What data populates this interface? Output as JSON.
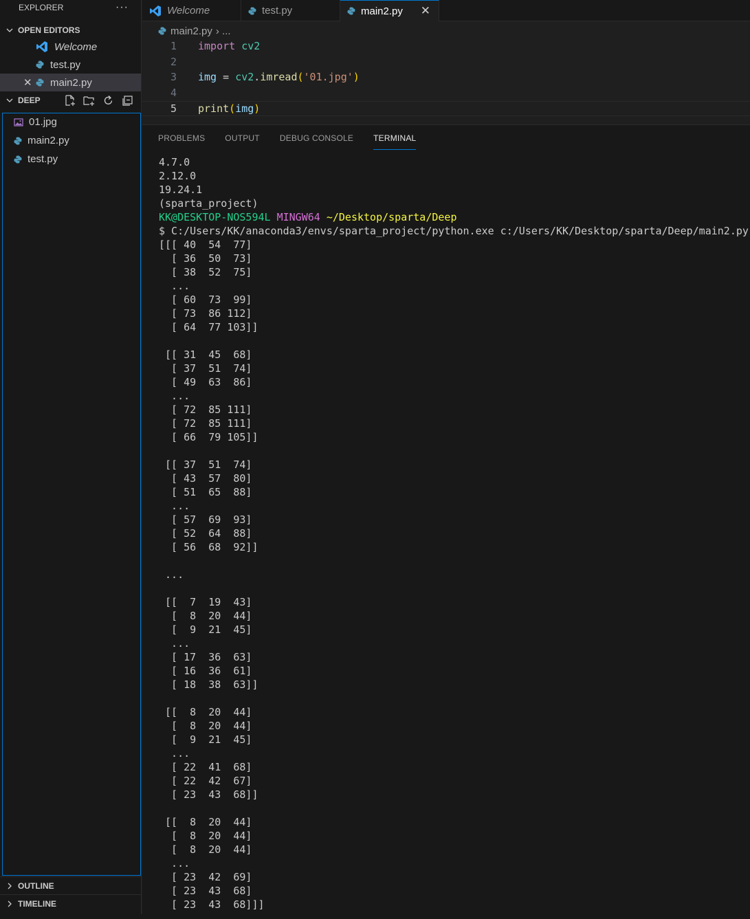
{
  "explorer": {
    "title": "EXPLORER",
    "more": "···",
    "open_editors_label": "OPEN EDITORS",
    "open_editors": [
      {
        "label": "Welcome",
        "icon": "vscode-icon"
      },
      {
        "label": "test.py",
        "icon": "python-icon"
      },
      {
        "label": "main2.py",
        "icon": "python-icon"
      }
    ],
    "folder_label": "DEEP",
    "files": [
      {
        "label": "01.jpg",
        "icon": "image-file-icon"
      },
      {
        "label": "main2.py",
        "icon": "python-icon"
      },
      {
        "label": "test.py",
        "icon": "python-icon"
      }
    ],
    "outline_label": "OUTLINE",
    "timeline_label": "TIMELINE"
  },
  "tabs": [
    {
      "label": "Welcome",
      "icon": "vscode-icon"
    },
    {
      "label": "test.py",
      "icon": "python-icon"
    },
    {
      "label": "main2.py",
      "icon": "python-icon",
      "close": "✕"
    }
  ],
  "breadcrumb": {
    "file": "main2.py",
    "rest": "› ..."
  },
  "editor": {
    "line_numbers": [
      "1",
      "2",
      "3",
      "4",
      "5"
    ],
    "line1": {
      "kw": "import",
      "mod": "cv2"
    },
    "line3": {
      "var": "img",
      "op": " = ",
      "mod": "cv2",
      "dot": ".",
      "fn": "imread",
      "open": "(",
      "str": "'01.jpg'",
      "close": ")"
    },
    "line5": {
      "fn": "print",
      "open": "(",
      "var": "img",
      "close": ")"
    }
  },
  "panel": {
    "tabs": [
      "PROBLEMS",
      "OUTPUT",
      "DEBUG CONSOLE",
      "TERMINAL"
    ]
  },
  "terminal": {
    "pre_lines": "4.7.0\n2.12.0\n19.24.1\n(sparta_project)",
    "prompt_user": "KK@DESKTOP-NOS594L",
    "prompt_shell": "MINGW64",
    "prompt_path": "~/Desktop/sparta/Deep",
    "command": "$ C:/Users/KK/anaconda3/envs/sparta_project/python.exe c:/Users/KK/Desktop/sparta/Deep/main2.py",
    "output": "[[[ 40  54  77]\n  [ 36  50  73]\n  [ 38  52  75]\n  ...\n  [ 60  73  99]\n  [ 73  86 112]\n  [ 64  77 103]]\n\n [[ 31  45  68]\n  [ 37  51  74]\n  [ 49  63  86]\n  ...\n  [ 72  85 111]\n  [ 72  85 111]\n  [ 66  79 105]]\n\n [[ 37  51  74]\n  [ 43  57  80]\n  [ 51  65  88]\n  ...\n  [ 57  69  93]\n  [ 52  64  88]\n  [ 56  68  92]]\n\n ...\n\n [[  7  19  43]\n  [  8  20  44]\n  [  9  21  45]\n  ...\n  [ 17  36  63]\n  [ 16  36  61]\n  [ 18  38  63]]\n\n [[  8  20  44]\n  [  8  20  44]\n  [  9  21  45]\n  ...\n  [ 22  41  68]\n  [ 22  42  67]\n  [ 23  43  68]]\n\n [[  8  20  44]\n  [  8  20  44]\n  [  8  20  44]\n  ...\n  [ 23  42  69]\n  [ 23  43  68]\n  [ 23  43  68]]]"
  },
  "colors": {
    "accent": "#0078d4",
    "python": "#519aba",
    "vscode": "#3ca0f0",
    "image": "#a074c4"
  }
}
